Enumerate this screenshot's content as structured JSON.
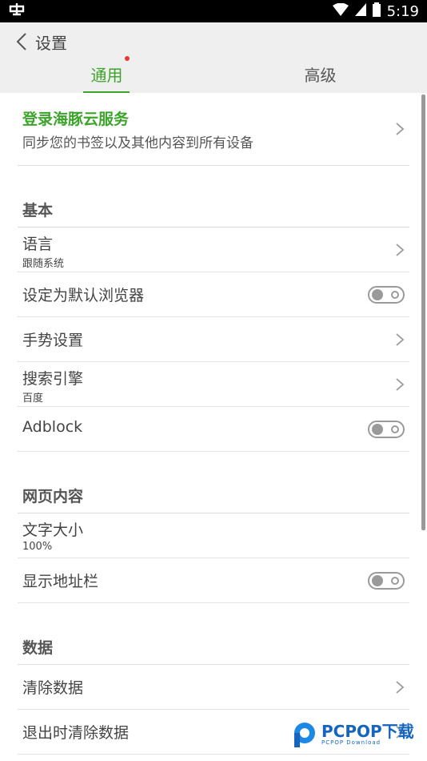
{
  "status_bar": {
    "time": "5:19"
  },
  "header": {
    "title": "设置"
  },
  "tabs": [
    {
      "label": "通用"
    },
    {
      "label": "高级"
    }
  ],
  "account": {
    "title": "登录海豚云服务",
    "subtitle": "同步您的书签以及其他内容到所有设备"
  },
  "sections": {
    "basic": {
      "title": "基本",
      "language": {
        "label": "语言",
        "value": "跟随系统"
      },
      "default_browser": {
        "label": "设定为默认浏览器",
        "enabled": false
      },
      "gesture": {
        "label": "手势设置"
      },
      "search_engine": {
        "label": "搜索引擎",
        "value": "百度"
      },
      "adblock": {
        "label": "Adblock",
        "enabled": false
      }
    },
    "web_content": {
      "title": "网页内容",
      "font_size": {
        "label": "文字大小",
        "value": "100%"
      },
      "show_address_bar": {
        "label": "显示地址栏",
        "enabled": false
      }
    },
    "data": {
      "title": "数据",
      "clear_data": {
        "label": "清除数据"
      },
      "clear_on_exit": {
        "label": "退出时清除数据"
      }
    }
  },
  "watermark": {
    "main": "PCPOP下载",
    "sub": "PCPOP Download"
  },
  "colors": {
    "accent": "#3da42b",
    "badge": "#e53935",
    "toolbar": "#efefef"
  }
}
